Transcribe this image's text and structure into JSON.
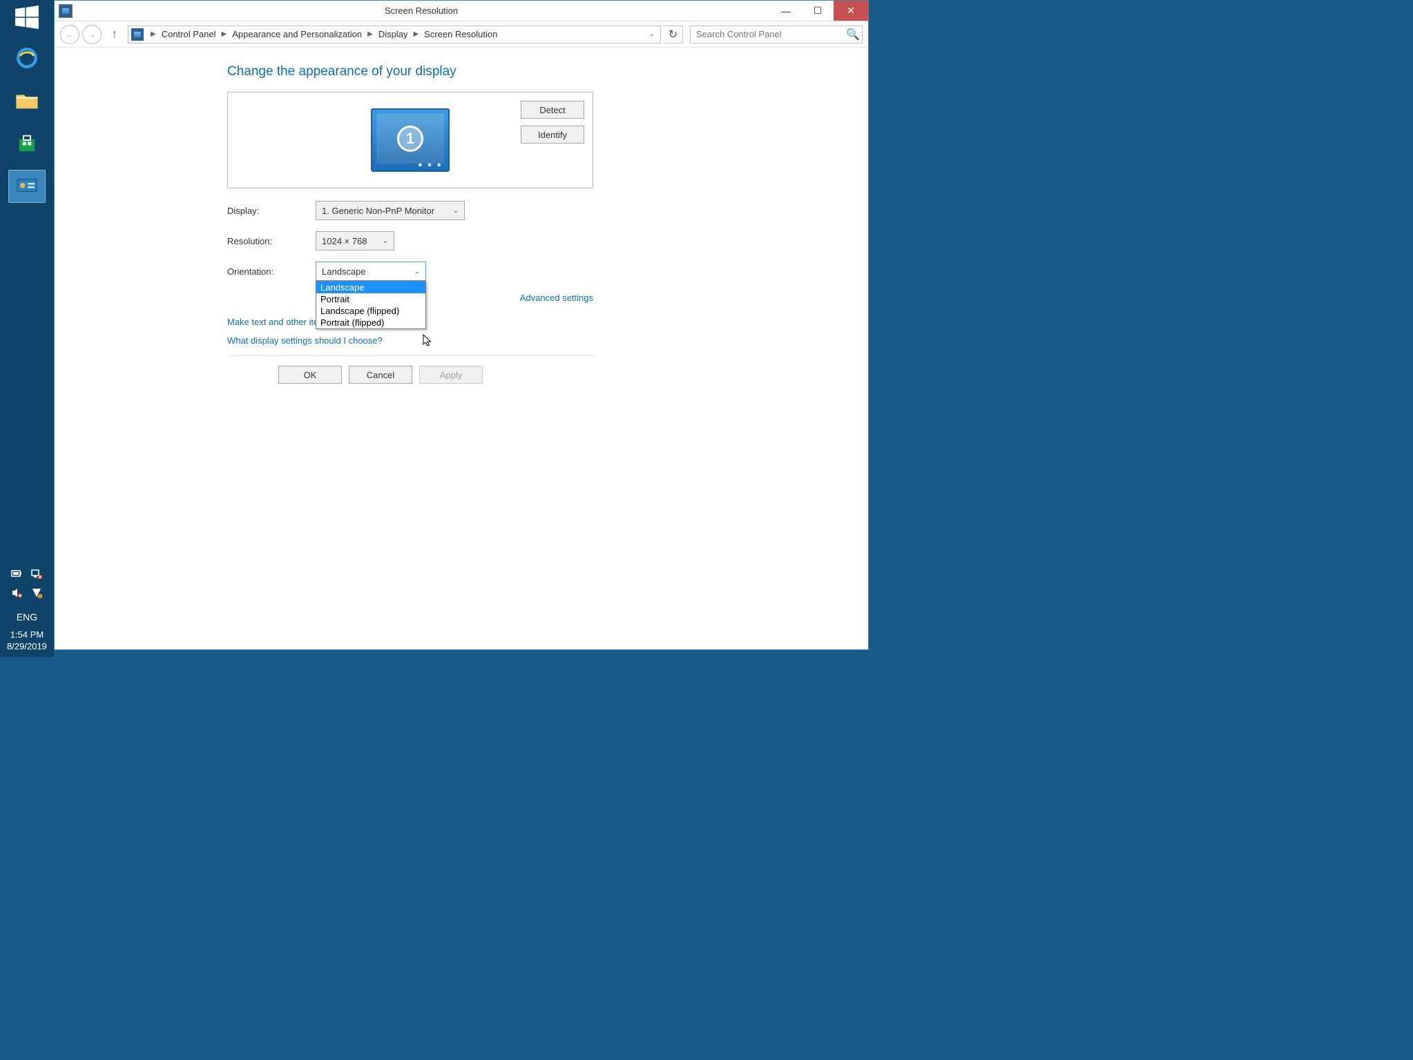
{
  "window": {
    "title": "Screen Resolution"
  },
  "breadcrumb": {
    "items": [
      "Control Panel",
      "Appearance and Personalization",
      "Display",
      "Screen Resolution"
    ]
  },
  "search": {
    "placeholder": "Search Control Panel"
  },
  "page": {
    "heading": "Change the appearance of your display",
    "monitor_number": "1",
    "detect": "Detect",
    "identify": "Identify",
    "display_label": "Display:",
    "display_value": "1. Generic Non-PnP Monitor",
    "resolution_label": "Resolution:",
    "resolution_value": "1024 × 768",
    "orientation_label": "Orientation:",
    "orientation_value": "Landscape",
    "orientation_options": [
      "Landscape",
      "Portrait",
      "Landscape (flipped)",
      "Portrait (flipped)"
    ],
    "advanced": "Advanced settings",
    "link_text_size": "Make text and other items larger or smaller",
    "link_help": "What display settings should I choose?",
    "ok": "OK",
    "cancel": "Cancel",
    "apply": "Apply"
  },
  "taskbar": {
    "lang": "ENG",
    "time": "1:54 PM",
    "date": "8/29/2019"
  }
}
